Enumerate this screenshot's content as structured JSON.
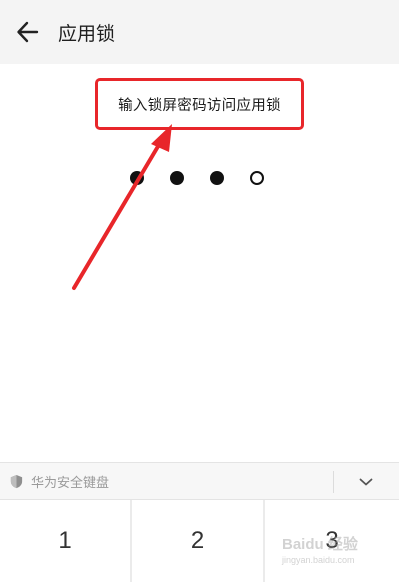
{
  "header": {
    "title": "应用锁",
    "back_icon": "arrow-left-icon"
  },
  "prompt": {
    "text": "输入锁屏密码访问应用锁",
    "highlight_color": "#e8262a"
  },
  "pin": {
    "total_digits": 4,
    "entered_digits": 3
  },
  "keyboard": {
    "label": "华为安全键盘",
    "shield_icon": "shield-icon",
    "collapse_icon": "chevron-down-icon",
    "keys": [
      "1",
      "2",
      "3"
    ]
  },
  "watermark": {
    "text": "Baidu 经验",
    "subtext": "jingyan.baidu.com"
  },
  "annotation": {
    "arrow_color": "#e8262a"
  }
}
